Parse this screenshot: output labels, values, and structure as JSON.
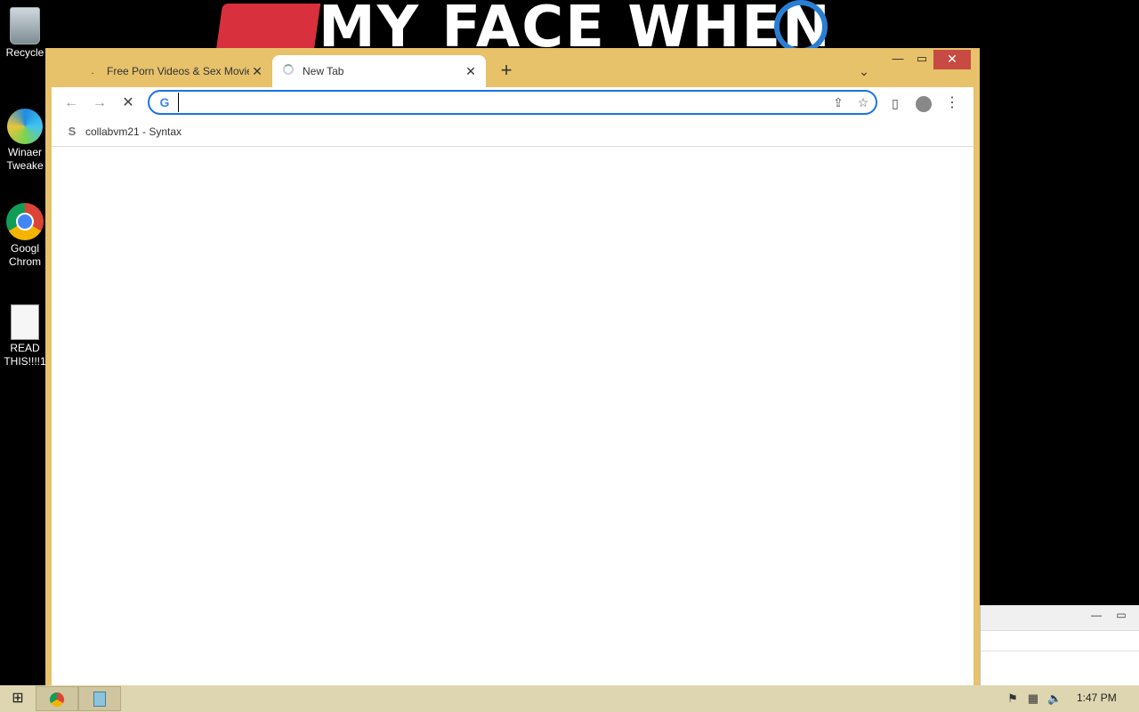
{
  "wallpaper": {
    "banner_text": "MY FACE WHEN"
  },
  "desktop_icons": [
    {
      "label_lines": [
        "Recycle"
      ]
    },
    {
      "label_lines": [
        "Winaer",
        "Tweake"
      ]
    },
    {
      "label_lines": [
        "Googl",
        "Chrom"
      ]
    },
    {
      "label_lines": [
        "READ",
        "THIS!!!!1"
      ]
    }
  ],
  "browser": {
    "tabs": [
      {
        "title": "Free Porn Videos & Sex Movies -",
        "favicon": "dot-icon",
        "active": false
      },
      {
        "title": "New Tab",
        "favicon": "loading-spinner",
        "active": true
      }
    ],
    "new_tab_symbol": "+",
    "omnibox": {
      "value": "",
      "placeholder": ""
    },
    "bookmarks": [
      {
        "label": "collabvm21 - Syntax",
        "icon": "syntax-icon"
      }
    ]
  },
  "taskbar": {
    "clock": "1:47 PM"
  },
  "colors": {
    "window_frame": "#e7c26b",
    "taskbar": "#ded6b0",
    "close_button": "#c74b42",
    "omnibox_focus": "#1a73e8"
  }
}
